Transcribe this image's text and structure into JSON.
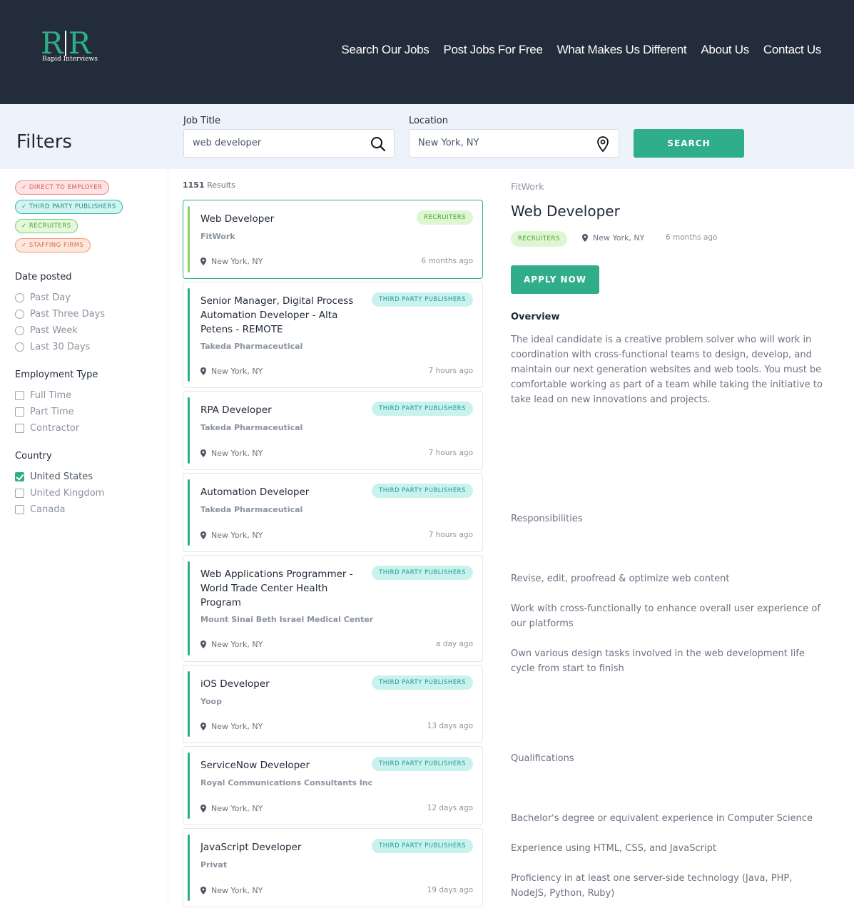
{
  "brand": {
    "letters_left": "R",
    "letters_right": "R",
    "tagline": "Rapid Interviews"
  },
  "nav": [
    "Search Our Jobs",
    "Post Jobs For Free",
    "What Makes Us Different",
    "About Us",
    "Contact Us"
  ],
  "search": {
    "filters_title": "Filters",
    "job_title_label": "Job Title",
    "job_title_value": "web developer",
    "location_label": "Location",
    "location_value": "New York, NY",
    "button": "SEARCH"
  },
  "sidebar": {
    "tags": [
      "DIRECT TO EMPLOYER",
      "THIRD PARTY PUBLISHERS",
      "RECRUITERS",
      "STAFFING FIRMS"
    ],
    "date_title": "Date posted",
    "date_options": [
      "Past Day",
      "Past Three Days",
      "Past Week",
      "Last 30 Days"
    ],
    "employment_title": "Employment Type",
    "employment_options": [
      "Full Time",
      "Part Time",
      "Contractor"
    ],
    "country_title": "Country",
    "country_options": [
      "United States",
      "United Kingdom",
      "Canada"
    ],
    "country_checked": "United States"
  },
  "results": {
    "count": "1151",
    "count_label": "Results",
    "jobs": [
      {
        "title": "Web Developer",
        "company": "FitWork",
        "badge": "RECRUITERS",
        "location": "New York, NY",
        "ago": "6 months ago"
      },
      {
        "title": "Senior Manager, Digital Process Automation Developer - Alta Petens - REMOTE",
        "company": "Takeda Pharmaceutical",
        "badge": "THIRD PARTY PUBLISHERS",
        "location": "New York, NY",
        "ago": "7 hours ago"
      },
      {
        "title": "RPA Developer",
        "company": "Takeda Pharmaceutical",
        "badge": "THIRD PARTY PUBLISHERS",
        "location": "New York, NY",
        "ago": "7 hours ago"
      },
      {
        "title": "Automation Developer",
        "company": "Takeda Pharmaceutical",
        "badge": "THIRD PARTY PUBLISHERS",
        "location": "New York, NY",
        "ago": "7 hours ago"
      },
      {
        "title": "Web Applications Programmer - World Trade Center Health Program",
        "company": "Mount Sinai Beth Israel Medical Center",
        "badge": "THIRD PARTY PUBLISHERS",
        "location": "New York, NY",
        "ago": "a day ago"
      },
      {
        "title": "iOS Developer",
        "company": "Yoop",
        "badge": "THIRD PARTY PUBLISHERS",
        "location": "New York, NY",
        "ago": "13 days ago"
      },
      {
        "title": "ServiceNow Developer",
        "company": "Royal Communications Consultants Inc",
        "badge": "THIRD PARTY PUBLISHERS",
        "location": "New York, NY",
        "ago": "12 days ago"
      },
      {
        "title": "JavaScript Developer",
        "company": "Privat",
        "badge": "THIRD PARTY PUBLISHERS",
        "location": "New York, NY",
        "ago": "19 days ago"
      }
    ]
  },
  "detail": {
    "company": "FitWork",
    "title": "Web Developer",
    "badge": "RECRUITERS",
    "location": "New York, NY",
    "ago": "6 months ago",
    "apply": "APPLY NOW",
    "overview_heading": "Overview",
    "overview": "The ideal candidate is a creative problem solver who will work in coordination with cross-functional teams to design, develop, and maintain our next generation websites and web tools. You must be comfortable working as part of a team while taking the initiative to take lead on new innovations and projects.",
    "responsibilities_heading": "Responsibilities",
    "responsibilities": [
      "Revise, edit, proofread & optimize web content",
      "Work with cross-functionally to enhance overall user experience of our platforms",
      "Own various design tasks involved in the web development life cycle from start to finish"
    ],
    "qualifications_heading": "Qualifications",
    "qualifications": [
      "Bachelor's degree or equivalent experience in Computer Science",
      "Experience using HTML, CSS, and JavaScript",
      "Proficiency in at least one server-side technology (Java, PHP, NodeJS, Python, Ruby)"
    ]
  }
}
